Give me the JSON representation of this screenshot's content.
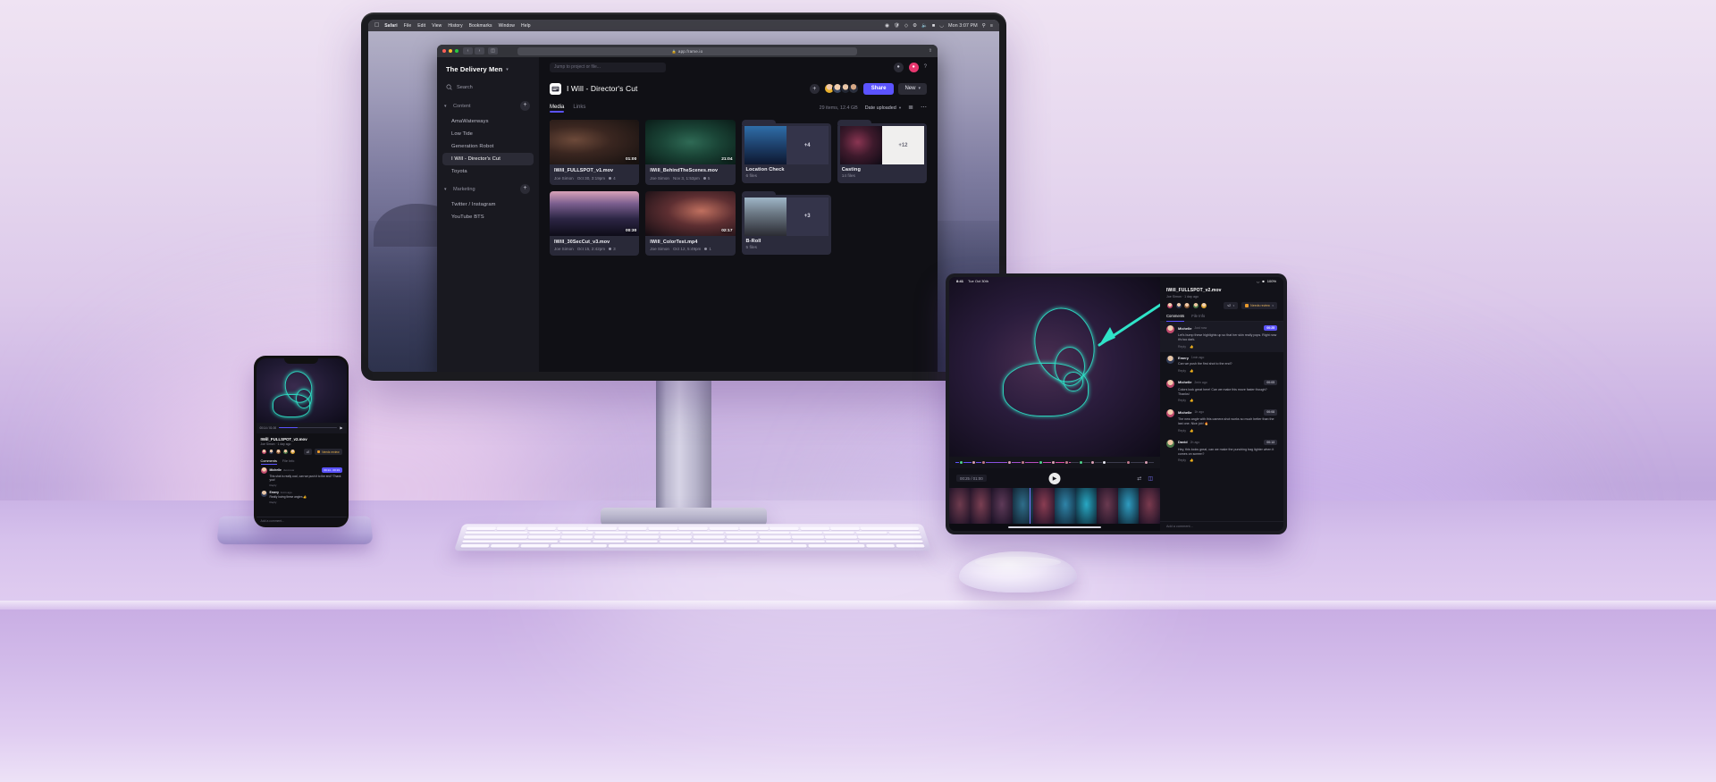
{
  "scene": {
    "description": "Frame.io video review app shown on Apple Pro Display XDR, iPad, and iPhone on a desk"
  },
  "macos": {
    "menubar": {
      "apple_glyph": "apple-logo-icon",
      "items": [
        "Safari",
        "File",
        "Edit",
        "View",
        "History",
        "Bookmarks",
        "Window",
        "Help"
      ],
      "status_icons": [
        "screen-record-icon",
        "shield-icon",
        "dropbox-icon",
        "bluetooth-icon",
        "volume-icon",
        "battery-icon",
        "wifi-icon",
        "control-center-icon"
      ],
      "clock": "Mon 3:07 PM",
      "search_icon": "search-icon",
      "menu_icon": "menu-icon"
    }
  },
  "safari": {
    "traffic_lights": [
      "close",
      "minimize",
      "maximize"
    ],
    "back_icon": "chevron-left-icon",
    "forward_icon": "chevron-right-icon",
    "sidebar_icon": "sidebar-icon",
    "url": "app.frame.io",
    "lock_icon": "lock-icon",
    "share_icon": "share-icon"
  },
  "sidebar": {
    "team_name": "The Delivery Men",
    "team_caret_icon": "chevron-down-icon",
    "search": {
      "label": "Search",
      "icon": "search-icon"
    },
    "groups": [
      {
        "name": "Content",
        "caret_icon": "chevron-down-icon",
        "add_icon": "plus-icon",
        "items": [
          {
            "label": "AmaWaterways",
            "active": false
          },
          {
            "label": "Low Tide",
            "active": false
          },
          {
            "label": "Generation Robot",
            "active": false
          },
          {
            "label": "I Will - Director's Cut",
            "active": true
          },
          {
            "label": "Toyota",
            "active": false
          }
        ]
      },
      {
        "name": "Marketing",
        "caret_icon": "chevron-down-icon",
        "add_icon": "plus-icon",
        "items": [
          {
            "label": "Twitter / Instagram",
            "active": false
          },
          {
            "label": "YouTube BTS",
            "active": false
          }
        ]
      }
    ]
  },
  "topbar": {
    "jump_placeholder": "Jump to project or file...",
    "account_icon": "user-icon",
    "notification_icon": "bell-icon",
    "help_icon": "question-mark-icon",
    "accent_color": "#5b53ff",
    "notification_color": "#e8376f"
  },
  "project": {
    "icon": "project-icon",
    "title": "I Will - Director's Cut",
    "add_member_icon": "plus-icon",
    "collaborators": 4,
    "share_label": "Share",
    "new_label": "New",
    "new_caret_icon": "chevron-down-icon"
  },
  "tabs": [
    {
      "label": "Media",
      "active": true
    },
    {
      "label": "Links",
      "active": false
    }
  ],
  "toolbar": {
    "item_count": "29 items, 12.4 GB",
    "sort_label": "Date uploaded",
    "sort_caret_icon": "chevron-down-icon",
    "list_view_icon": "list-view-icon",
    "more_icon": "ellipsis-icon"
  },
  "grid": {
    "files": [
      {
        "type": "file",
        "name": "IWill_FULLSPOT_v1.mov",
        "owner": "Joe Simon",
        "date": "Oct 30, 3:19pm",
        "duration": "01:00",
        "comments": "4",
        "comment_icon": "comment-icon"
      },
      {
        "type": "file",
        "name": "IWill_BehindTheScenes.mov",
        "owner": "Joe Simon",
        "date": "Nov 3, 1:53pm",
        "duration": "21:04",
        "comments": "5",
        "comment_icon": "comment-icon"
      },
      {
        "type": "folder",
        "name": "Location Check",
        "files_label": "6 files",
        "overflow": "+4"
      },
      {
        "type": "folder",
        "name": "Casting",
        "files_label": "14 files",
        "overflow": "+12"
      },
      {
        "type": "file",
        "name": "IWill_30SecCut_v3.mov",
        "owner": "Joe Simon",
        "date": "Oct 15, 2:42pm",
        "duration": "00:30",
        "comments": "3",
        "comment_icon": "comment-icon"
      },
      {
        "type": "file",
        "name": "IWill_ColorTest.mp4",
        "owner": "Joe Simon",
        "date": "Oct 12, 5:49pm",
        "duration": "02:17",
        "comments": "1",
        "comment_icon": "comment-icon"
      },
      {
        "type": "folder",
        "name": "B-Roll",
        "files_label": "5 files",
        "overflow": "+3"
      }
    ]
  },
  "tablet": {
    "statusbar": {
      "time": "8:41",
      "date": "Tue Oct 30th",
      "wifi_icon": "wifi-icon",
      "battery_icon": "battery-icon",
      "battery_label": "100%"
    },
    "file": {
      "name": "IWill_FULLSPOT_v2.mov",
      "sub": "Joe Simon · 1 day ago",
      "version_label": "v2",
      "version_caret_icon": "chevron-down-icon",
      "status_label": "Needs review",
      "status_caret_icon": "chevron-down-icon",
      "status_color": "#e9992b"
    },
    "tabs": [
      {
        "label": "Comments",
        "active": true
      },
      {
        "label": "File Info",
        "active": false
      }
    ],
    "comments": [
      {
        "author": "Michelle",
        "time": "Just now",
        "text": "Let's bump these highlights up so that her skin really pops. Right now it's too dark.",
        "stamp": "00:25",
        "reply_label": "Reply",
        "like_icon": "thumbs-up-icon",
        "highlighted": true
      },
      {
        "author": "Emery",
        "time": "1min ago",
        "text": "Can we push the first shot to the end?",
        "stamp": "",
        "reply_label": "Reply",
        "like_icon": "thumbs-up-icon",
        "highlighted": false
      },
      {
        "author": "Michelle",
        "time": "2min ago",
        "text": "Colors look great here! Can we make this move faster though? Thanks!",
        "stamp": "00:05",
        "reply_label": "Reply",
        "like_icon": "thumbs-up-icon",
        "highlighted": false
      },
      {
        "author": "Michelle",
        "time": "1h ago",
        "text": "The new angle with this camera shot works so much better than the last one. Nice job! 🔥",
        "stamp": "00:08",
        "reply_label": "Reply",
        "like_icon": "thumbs-up-icon",
        "highlighted": false
      },
      {
        "author": "David",
        "time": "2h ago",
        "text": "Hey, this looks great, can we make the punching bag lighter when it comes on screen?",
        "stamp": "00:13",
        "reply_label": "Reply",
        "like_icon": "thumbs-up-icon",
        "highlighted": false
      }
    ],
    "input_placeholder": "Add a comment...",
    "player": {
      "time_display": "00:25 / 01:00",
      "play_icon": "play-icon",
      "loop_icon": "loop-icon",
      "compare_icon": "compare-icon"
    }
  },
  "phone": {
    "file": {
      "name": "IWill_FULLSPOT_v2.mov",
      "sub": "Joe Simon · 1 day ago",
      "version_label": "v2",
      "status_label": "Needs review"
    },
    "tabs": [
      {
        "label": "Comments",
        "active": true
      },
      {
        "label": "File Info",
        "active": false
      }
    ],
    "comments": [
      {
        "author": "Michelle",
        "time": "Just now",
        "text": "This shot is really cool, can we push it to the end? Thank you!",
        "stamp": "00:14 - 00:19",
        "reply_label": "Reply"
      },
      {
        "author": "Emery",
        "time": "1min ago",
        "text": "Really loving these angles 👍",
        "stamp": "",
        "reply_label": "Reply"
      }
    ],
    "input_placeholder": "Add a comment...",
    "time_display": "00:14 / 01:00"
  }
}
